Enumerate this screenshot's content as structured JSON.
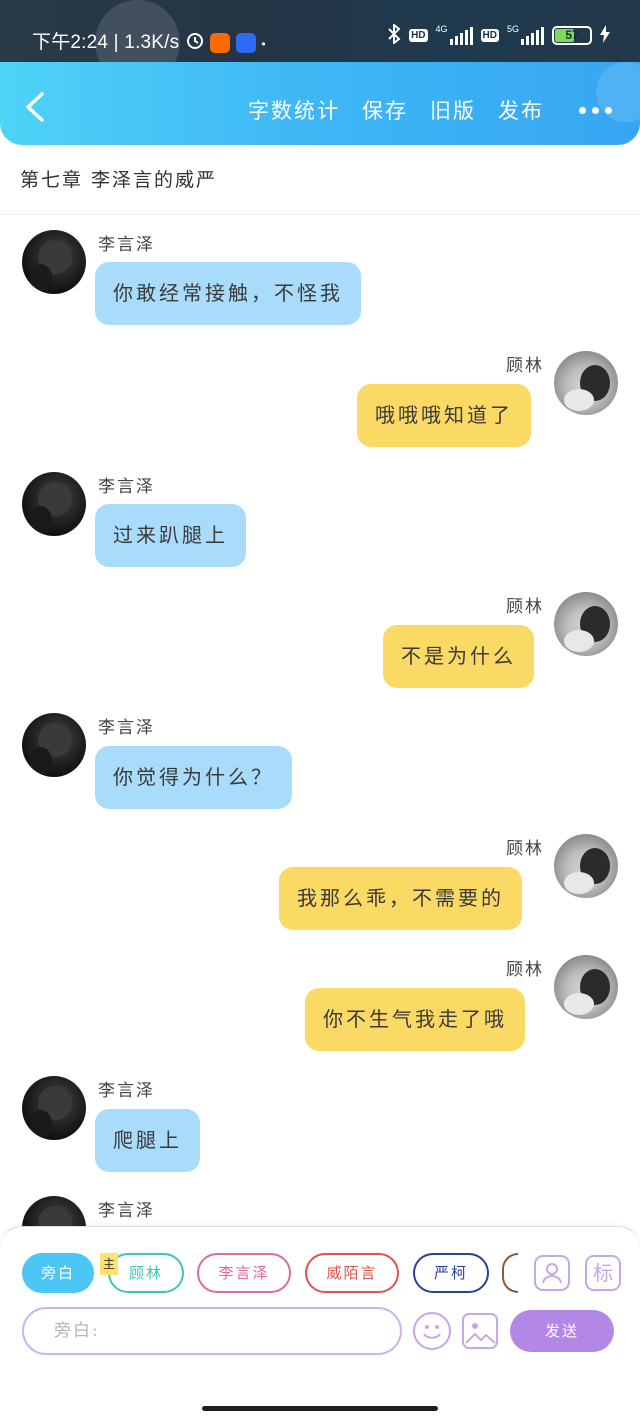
{
  "status_bar": {
    "time": "下午2:24",
    "separator": "|",
    "speed": "1.3K/s",
    "dot": "•",
    "hd1": "HD",
    "net1": "4G",
    "hd2": "HD",
    "net2": "5G",
    "battery": "57"
  },
  "header": {
    "actions": [
      "字数统计",
      "保存",
      "旧版",
      "发布"
    ]
  },
  "chapter_title": "第七章 李泽言的威严",
  "messages": [
    {
      "side": "left",
      "sender": "李言泽",
      "text": "你敢经常接触，不怪我"
    },
    {
      "side": "right",
      "sender": "顾林",
      "text": "哦哦哦知道了"
    },
    {
      "side": "left",
      "sender": "李言泽",
      "text": "过来趴腿上"
    },
    {
      "side": "right",
      "sender": "顾林",
      "text": "不是为什么"
    },
    {
      "side": "left",
      "sender": "李言泽",
      "text": "你觉得为什么？"
    },
    {
      "side": "right",
      "sender": "顾林",
      "text": "我那么乖，不需要的"
    },
    {
      "side": "right",
      "sender": "顾林",
      "text": "你不生气我走了哦"
    },
    {
      "side": "left",
      "sender": "李言泽",
      "text": "爬腿上"
    },
    {
      "side": "left",
      "sender": "李言泽",
      "text": ""
    }
  ],
  "roles": {
    "chips": [
      {
        "label": "旁白",
        "color": "#4bc6f5",
        "active": true
      },
      {
        "label": "顾林",
        "color": "#3cc6b3"
      },
      {
        "label": "李言泽",
        "color": "#e06a9a"
      },
      {
        "label": "威陌言",
        "color": "#e0524f"
      },
      {
        "label": "严柯",
        "color": "#2a3f9e"
      }
    ],
    "main_tag": "主",
    "tag_icon": "标"
  },
  "composer": {
    "placeholder": "旁白:",
    "send_label": "发送"
  },
  "colors": {
    "header_start": "#4fd3f7",
    "header_end": "#36a6f3",
    "left_bubble": "#a9dcfb",
    "right_bubble": "#fbd965",
    "send_button": "#b287e6"
  },
  "icons": [
    "back-arrow-icon",
    "more-icon",
    "add-role-icon",
    "tag-icon",
    "emoji-icon",
    "image-icon",
    "bluetooth-icon",
    "alarm-icon",
    "signal-icon",
    "battery-icon"
  ]
}
